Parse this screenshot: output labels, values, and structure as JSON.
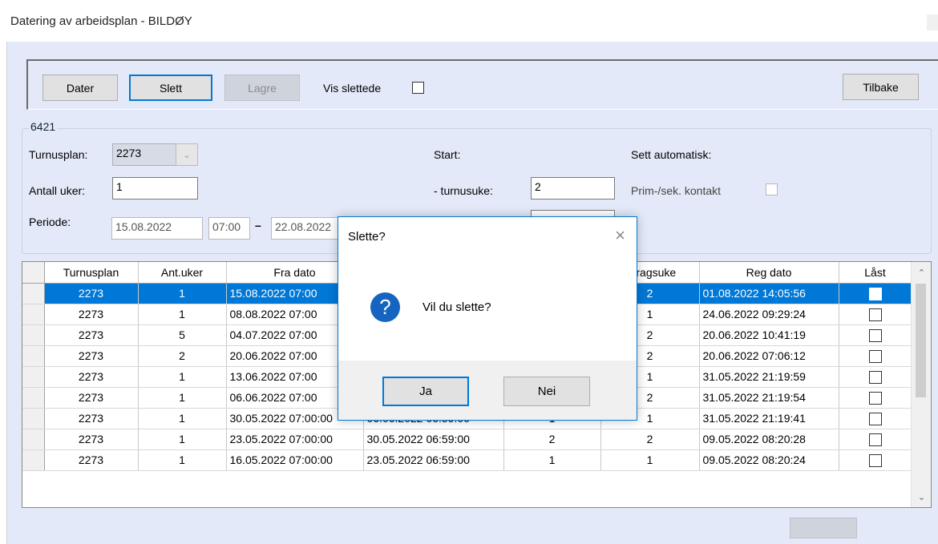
{
  "window": {
    "title": "Datering av arbeidsplan - BILDØY"
  },
  "toolbar": {
    "dater_label": "Dater",
    "slett_label": "Slett",
    "lagre_label": "Lagre",
    "vis_slettede_label": "Vis slettede",
    "tilbake_label": "Tilbake"
  },
  "group": {
    "title": "6421",
    "turnusplan_label": "Turnusplan:",
    "turnusplan_value": "2273",
    "antall_uker_label": "Antall uker:",
    "antall_uker_value": "1",
    "periode_label": "Periode:",
    "periode_from_date": "15.08.2022",
    "periode_from_time": "07:00",
    "periode_sep": "–",
    "periode_to_date": "22.08.2022",
    "start_label": "Start:",
    "turnusuke_label": "- turnusuke:",
    "turnusuke_value": "2",
    "sett_auto_label": "Sett automatisk:",
    "prim_sek_label": "Prim-/sek. kontakt"
  },
  "grid": {
    "columns": [
      "Turnusplan",
      "Ant.uker",
      "Fra dato",
      "",
      "",
      "odragsuke",
      "Reg dato",
      "Låst"
    ],
    "rows": [
      {
        "turnusplan": "2273",
        "antuker": "1",
        "fra": "15.08.2022 07:00",
        "til": "",
        "turnusuke": "",
        "oppdrag": "2",
        "reg": "01.08.2022 14:05:56"
      },
      {
        "turnusplan": "2273",
        "antuker": "1",
        "fra": "08.08.2022 07:00",
        "til": "",
        "turnusuke": "",
        "oppdrag": "1",
        "reg": "24.06.2022 09:29:24"
      },
      {
        "turnusplan": "2273",
        "antuker": "5",
        "fra": "04.07.2022 07:00",
        "til": "",
        "turnusuke": "",
        "oppdrag": "2",
        "reg": "20.06.2022 10:41:19"
      },
      {
        "turnusplan": "2273",
        "antuker": "2",
        "fra": "20.06.2022 07:00",
        "til": "",
        "turnusuke": "",
        "oppdrag": "2",
        "reg": "20.06.2022 07:06:12"
      },
      {
        "turnusplan": "2273",
        "antuker": "1",
        "fra": "13.06.2022 07:00",
        "til": "",
        "turnusuke": "",
        "oppdrag": "1",
        "reg": "31.05.2022 21:19:59"
      },
      {
        "turnusplan": "2273",
        "antuker": "1",
        "fra": "06.06.2022 07:00",
        "til": "",
        "turnusuke": "",
        "oppdrag": "2",
        "reg": "31.05.2022 21:19:54"
      },
      {
        "turnusplan": "2273",
        "antuker": "1",
        "fra": "30.05.2022 07:00:00",
        "til": "06.06.2022 06:59:00",
        "turnusuke": "1",
        "oppdrag": "1",
        "reg": "31.05.2022 21:19:41"
      },
      {
        "turnusplan": "2273",
        "antuker": "1",
        "fra": "23.05.2022 07:00:00",
        "til": "30.05.2022 06:59:00",
        "turnusuke": "2",
        "oppdrag": "2",
        "reg": "09.05.2022 08:20:28"
      },
      {
        "turnusplan": "2273",
        "antuker": "1",
        "fra": "16.05.2022 07:00:00",
        "til": "23.05.2022 06:59:00",
        "turnusuke": "1",
        "oppdrag": "1",
        "reg": "09.05.2022 08:20:24"
      }
    ]
  },
  "dialog": {
    "title": "Slette?",
    "message": "Vil du slette?",
    "icon": "question-icon",
    "yes_label": "Ja",
    "no_label": "Nei"
  },
  "colors": {
    "accent": "#0078d7",
    "client_bg": "#e3e9f8"
  }
}
